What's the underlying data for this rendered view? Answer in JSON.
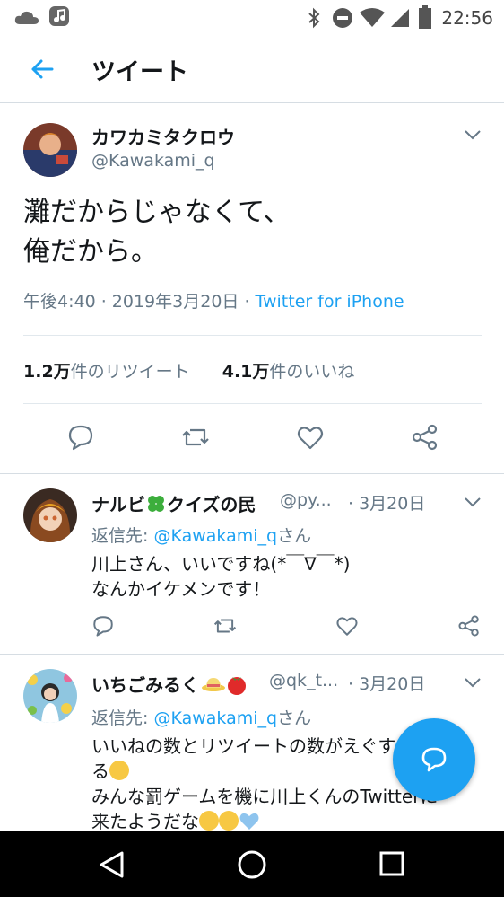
{
  "status_bar": {
    "time": "22:56"
  },
  "app_bar": {
    "title": "ツイート"
  },
  "main_tweet": {
    "name": "カワカミタクロウ",
    "handle": "@Kawakami_q",
    "text_line1": "灘だからじゃなくて、",
    "text_line2": "俺だから。",
    "timestamp": "午後4:40 · 2019年3月20日 · ",
    "source": "Twitter for iPhone",
    "retweet_count": "1.2万",
    "retweet_suffix": "件のリツイート",
    "like_count": "4.1万",
    "like_suffix": "件のいいね"
  },
  "replies": [
    {
      "name": "ナルビ",
      "name_suffix": "クイズの民",
      "handle": "@py...",
      "date": "· 3月20日",
      "reply_to_prefix": "返信先: ",
      "reply_to": "@Kawakami_q",
      "reply_to_suffix": "さん",
      "line1": "川上さん、いいですね(*￣∇￣*)",
      "line2": "なんかイケメンです！"
    },
    {
      "name": "いちごみるく",
      "handle": "@qk_t...",
      "date": "· 3月20日",
      "reply_to_prefix": "返信先: ",
      "reply_to": "@Kawakami_q",
      "reply_to_suffix": "さん",
      "line1": "いいねの数とリツイートの数がえぐすぎて",
      "line2": "る",
      "line3": "みんな罰ゲームを機に川上くんのTwitterに",
      "line4": "来たようだな"
    }
  ],
  "colors": {
    "accent": "#1da1f2",
    "secondary_text": "#657786",
    "divider": "#e1e8ed"
  }
}
